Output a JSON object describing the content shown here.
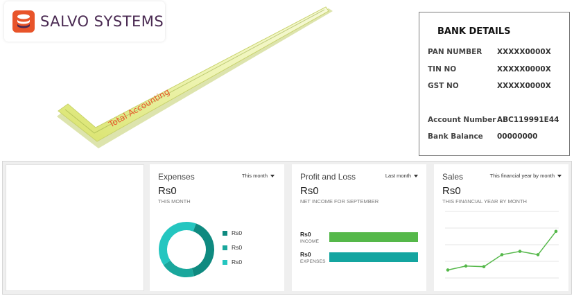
{
  "brand": {
    "name": "SALVO SYSTEMS",
    "logo_icon": "stack-coins-icon",
    "logo_color": "#e8542a"
  },
  "graphic": {
    "check_text": "Total Accounting",
    "check_color": "#e8ef9a",
    "text_color": "#e8542a"
  },
  "bank": {
    "title": "BANK DETAILS",
    "rows": [
      {
        "label": "PAN NUMBER",
        "value": "XXXXX0000X"
      },
      {
        "label": "TIN NO",
        "value": "XXXXX0000X"
      },
      {
        "label": "GST NO",
        "value": "XXXXX0000X"
      },
      {
        "label": "Account Number",
        "value": "ABC119991E44"
      },
      {
        "label": "Bank Balance",
        "value": "00000000"
      }
    ]
  },
  "expenses": {
    "title": "Expenses",
    "filter": "This month",
    "amount": "Rs0",
    "subtitle": "THIS MONTH",
    "legend": [
      {
        "label": "Rs0",
        "color": "#0f8a80"
      },
      {
        "label": "Rs0",
        "color": "#1aa79c"
      },
      {
        "label": "Rs0",
        "color": "#25c6c0"
      }
    ]
  },
  "profit_loss": {
    "title": "Profit and Loss",
    "filter": "Last month",
    "amount": "Rs0",
    "subtitle": "NET INCOME FOR SEPTEMBER",
    "income": {
      "amount": "Rs0",
      "label": "INCOME",
      "color": "#55b84a",
      "fill": 1.0
    },
    "expenses": {
      "amount": "Rs0",
      "label": "EXPENSES",
      "color": "#14a5a0",
      "fill": 1.0
    }
  },
  "sales": {
    "title": "Sales",
    "filter": "This financial year by month",
    "amount": "Rs0",
    "subtitle": "THIS FINANCIAL YEAR BY MONTH",
    "line_color": "#55b84a"
  },
  "chart_data": [
    {
      "type": "pie",
      "title": "",
      "donut": true,
      "slices": [
        {
          "label": "Rs0",
          "value": 40,
          "color": "#0f8a80"
        },
        {
          "label": "Rs0",
          "value": 20,
          "color": "#1aa79c"
        },
        {
          "label": "Rs0",
          "value": 40,
          "color": "#25c6c0"
        }
      ]
    },
    {
      "type": "line",
      "title": "",
      "x": [
        1,
        2,
        3,
        4,
        5,
        6,
        7,
        8
      ],
      "series": [
        {
          "values": [
            1.2,
            1.8,
            1.7,
            3.5,
            4.0,
            3.5,
            7.0,
            7.0
          ]
        }
      ],
      "ylim": [
        0,
        10
      ],
      "grid": true,
      "points": 7
    }
  ]
}
